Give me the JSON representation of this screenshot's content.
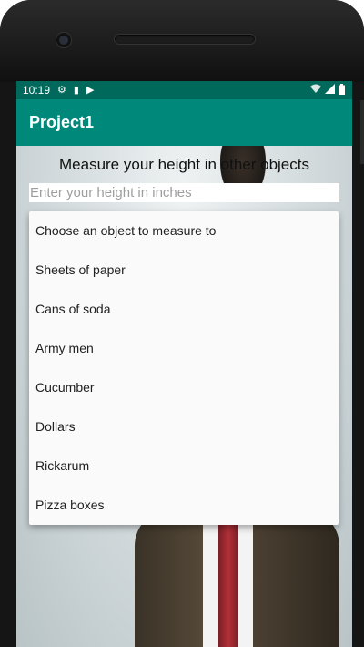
{
  "status_bar": {
    "time": "10:19",
    "left_icons": [
      "gear-icon",
      "sd-card-icon",
      "play-store-icon"
    ],
    "right_icons": [
      "wifi-icon",
      "cell-signal-icon",
      "battery-icon"
    ]
  },
  "app_bar": {
    "title": "Project1"
  },
  "main": {
    "heading": "Measure your height in other objects",
    "height_input": {
      "value": "",
      "placeholder": "Enter your height in inches"
    },
    "object_dropdown": {
      "items": [
        "Choose an object to measure to",
        "Sheets of paper",
        "Cans of soda",
        "Army men",
        "Cucumber",
        "Dollars",
        "Rickarum",
        "Pizza boxes"
      ]
    }
  },
  "colors": {
    "status_bar": "#00695c",
    "app_bar": "#00897b",
    "dropdown_bg": "#fafafa"
  }
}
